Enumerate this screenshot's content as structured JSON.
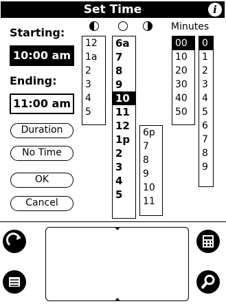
{
  "title": "Set Time",
  "starting_label": "Starting:",
  "start_value": "10:00 am",
  "ending_label": "Ending:",
  "end_value": "11:00 am",
  "buttons": {
    "duration": "Duration",
    "no_time": "No Time",
    "ok": "OK",
    "cancel": "Cancel"
  },
  "minutes_label": "Minutes",
  "hours_col1": [
    "12",
    "1a",
    "2",
    "3",
    "4",
    "5"
  ],
  "hours_col2": [
    "6a",
    "7",
    "8",
    "9",
    "10",
    "11",
    "12",
    "1p",
    "2",
    "3",
    "4",
    "5"
  ],
  "hours_col3": [
    "6p",
    "7",
    "8",
    "9",
    "10",
    "11"
  ],
  "minutes_tens": [
    "00",
    "10",
    "20",
    "30",
    "40",
    "50"
  ],
  "minutes_ones": [
    "0",
    "1",
    "2",
    "3",
    "4",
    "5",
    "6",
    "7",
    "8",
    "9"
  ],
  "selected": {
    "hour": "10",
    "minute_tens": "00",
    "minute_ones": "0"
  },
  "icons": {
    "info": "info-icon",
    "night": "half-moon-left-icon",
    "day": "empty-circle-icon",
    "evening": "half-moon-right-icon",
    "home": "home-icon",
    "calc": "calculator-icon",
    "menu": "menu-icon",
    "find": "find-icon"
  }
}
